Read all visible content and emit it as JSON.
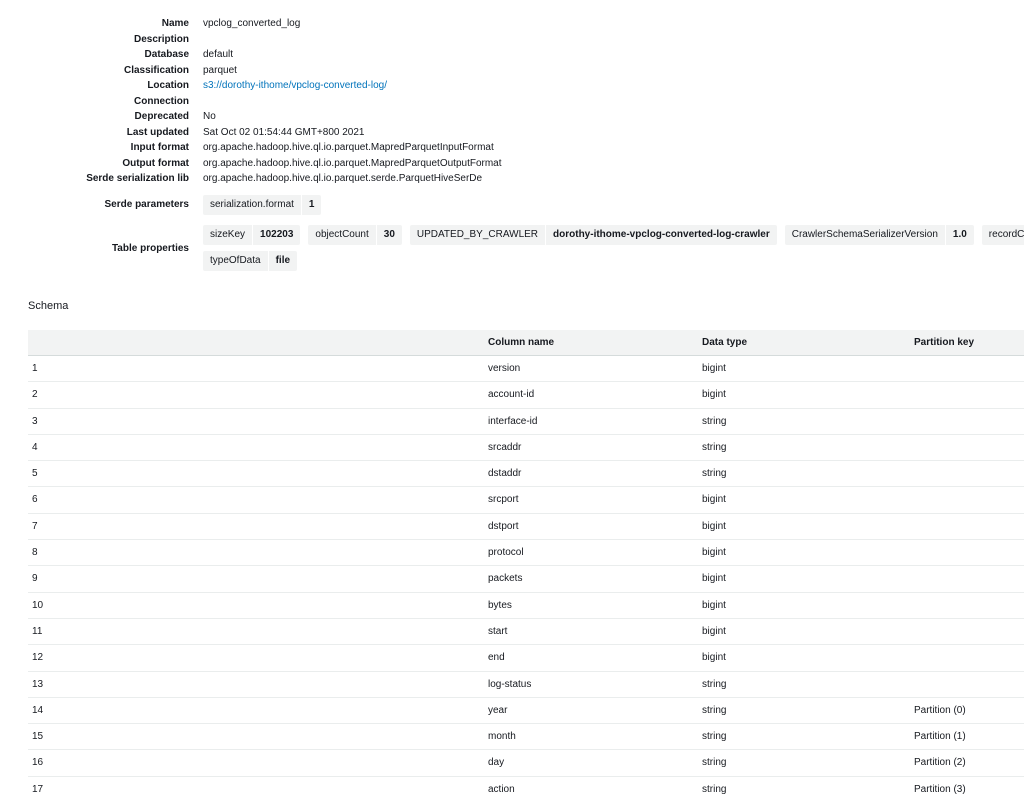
{
  "details": {
    "rows": [
      {
        "label": "Name",
        "value": "vpclog_converted_log"
      },
      {
        "label": "Description",
        "value": ""
      },
      {
        "label": "Database",
        "value": "default"
      },
      {
        "label": "Classification",
        "value": "parquet"
      },
      {
        "label": "Location",
        "value": "s3://dorothy-ithome/vpclog-converted-log/"
      },
      {
        "label": "Connection",
        "value": ""
      },
      {
        "label": "Deprecated",
        "value": "No"
      },
      {
        "label": "Last updated",
        "value": "Sat Oct 02 01:54:44 GMT+800 2021"
      },
      {
        "label": "Input format",
        "value": "org.apache.hadoop.hive.ql.io.parquet.MapredParquetInputFormat"
      },
      {
        "label": "Output format",
        "value": "org.apache.hadoop.hive.ql.io.parquet.MapredParquetOutputFormat"
      },
      {
        "label": "Serde serialization lib",
        "value": "org.apache.hadoop.hive.ql.io.parquet.serde.ParquetHiveSerDe"
      }
    ],
    "serde_parameters": {
      "label": "Serde parameters",
      "pairs": [
        {
          "key": "serialization.format",
          "value": "1"
        }
      ]
    },
    "table_properties": {
      "label": "Table properties",
      "line1": [
        {
          "key": "sizeKey",
          "value": "102203"
        },
        {
          "key": "objectCount",
          "value": "30"
        },
        {
          "key": "UPDATED_BY_CRAWLER",
          "value": "dorothy-ithome-vpclog-converted-log-crawler"
        },
        {
          "key": "CrawlerSchemaSerializerVersion",
          "value": "1.0"
        },
        {
          "key": "recordCount",
          "value": ""
        }
      ],
      "line2": [
        {
          "key": "typeOfData",
          "value": "file"
        }
      ]
    }
  },
  "schema": {
    "title": "Schema",
    "headers": {
      "num": "",
      "name": "Column name",
      "type": "Data type",
      "partition": "Partition key"
    },
    "rows": [
      {
        "num": "1",
        "name": "version",
        "type": "bigint",
        "partition": ""
      },
      {
        "num": "2",
        "name": "account-id",
        "type": "bigint",
        "partition": ""
      },
      {
        "num": "3",
        "name": "interface-id",
        "type": "string",
        "partition": ""
      },
      {
        "num": "4",
        "name": "srcaddr",
        "type": "string",
        "partition": ""
      },
      {
        "num": "5",
        "name": "dstaddr",
        "type": "string",
        "partition": ""
      },
      {
        "num": "6",
        "name": "srcport",
        "type": "bigint",
        "partition": ""
      },
      {
        "num": "7",
        "name": "dstport",
        "type": "bigint",
        "partition": ""
      },
      {
        "num": "8",
        "name": "protocol",
        "type": "bigint",
        "partition": ""
      },
      {
        "num": "9",
        "name": "packets",
        "type": "bigint",
        "partition": ""
      },
      {
        "num": "10",
        "name": "bytes",
        "type": "bigint",
        "partition": ""
      },
      {
        "num": "11",
        "name": "start",
        "type": "bigint",
        "partition": ""
      },
      {
        "num": "12",
        "name": "end",
        "type": "bigint",
        "partition": ""
      },
      {
        "num": "13",
        "name": "log-status",
        "type": "string",
        "partition": ""
      },
      {
        "num": "14",
        "name": "year",
        "type": "string",
        "partition": "Partition (0)"
      },
      {
        "num": "15",
        "name": "month",
        "type": "string",
        "partition": "Partition (1)"
      },
      {
        "num": "16",
        "name": "day",
        "type": "string",
        "partition": "Partition (2)"
      },
      {
        "num": "17",
        "name": "action",
        "type": "string",
        "partition": "Partition (3)"
      }
    ]
  }
}
